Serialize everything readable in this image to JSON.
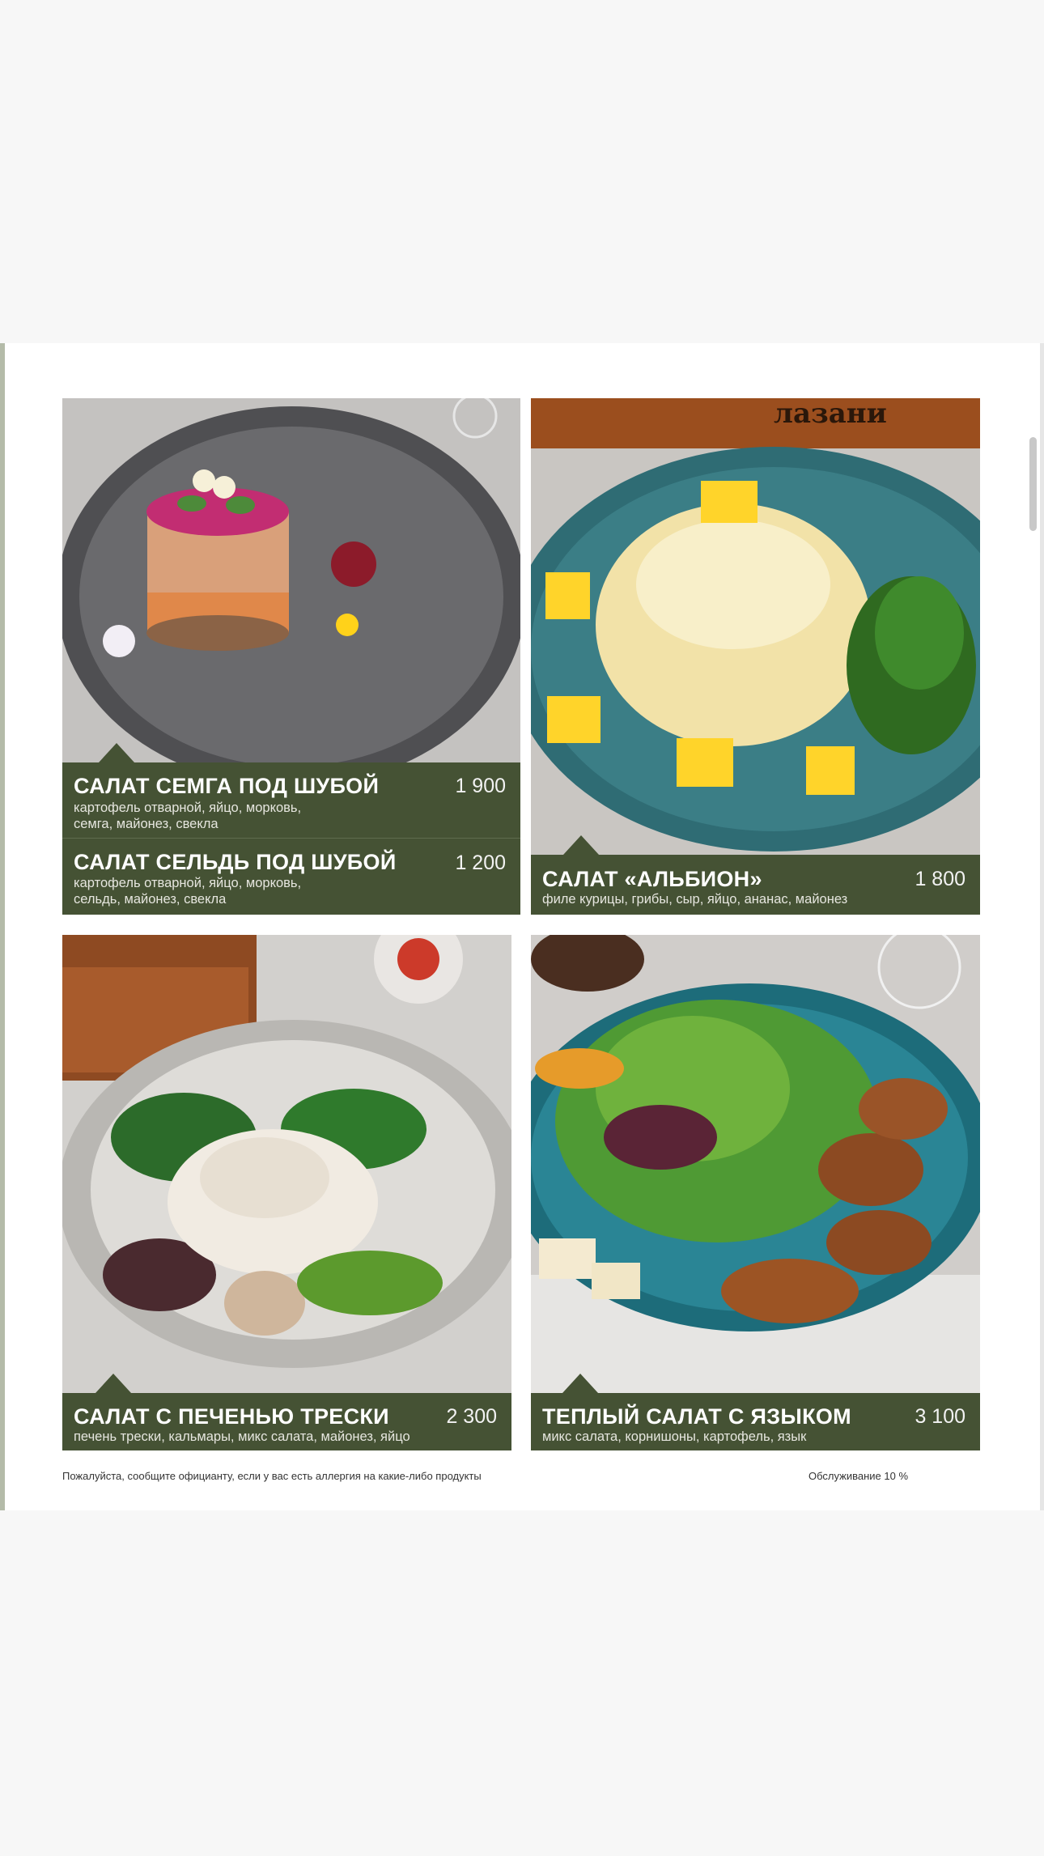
{
  "menu": {
    "items": [
      {
        "name": "САЛАТ СЕМГА ПОД ШУБОЙ",
        "price": "1 900",
        "desc_line1": "картофель отварной, яйцо, морковь,",
        "desc_line2": "семга, майонез, свекла"
      },
      {
        "name": "САЛАТ СЕЛЬДЬ ПОД ШУБОЙ",
        "price": "1 200",
        "desc_line1": "картофель отварной, яйцо, морковь,",
        "desc_line2": "сельдь, майонез, свекла"
      },
      {
        "name": "САЛАТ «АЛЬБИОН»",
        "price": "1 800",
        "desc_line1": "филе курицы, грибы, сыр, яйцо, ананас, майонез"
      },
      {
        "name": "САЛАТ С ПЕЧЕНЬЮ ТРЕСКИ",
        "price": "2 300",
        "desc_line1": "печень трески, кальмары,  микс салата, майонез, яйцо"
      },
      {
        "name": "ТЕПЛЫЙ САЛАТ С ЯЗЫКОМ",
        "price": "3 100",
        "desc_line1": "микс салата, корнишоны, картофель, язык"
      }
    ],
    "sign_text": "лазани"
  },
  "footer": {
    "allergy_note": "Пожалуйста, сообщите официанту, если у вас есть аллергия на какие-либо продукты",
    "service_note": "Обслуживание 10 %"
  },
  "colors": {
    "panel": "#455234",
    "page_background": "#ffffff",
    "outer_background": "#f7f7f7"
  }
}
